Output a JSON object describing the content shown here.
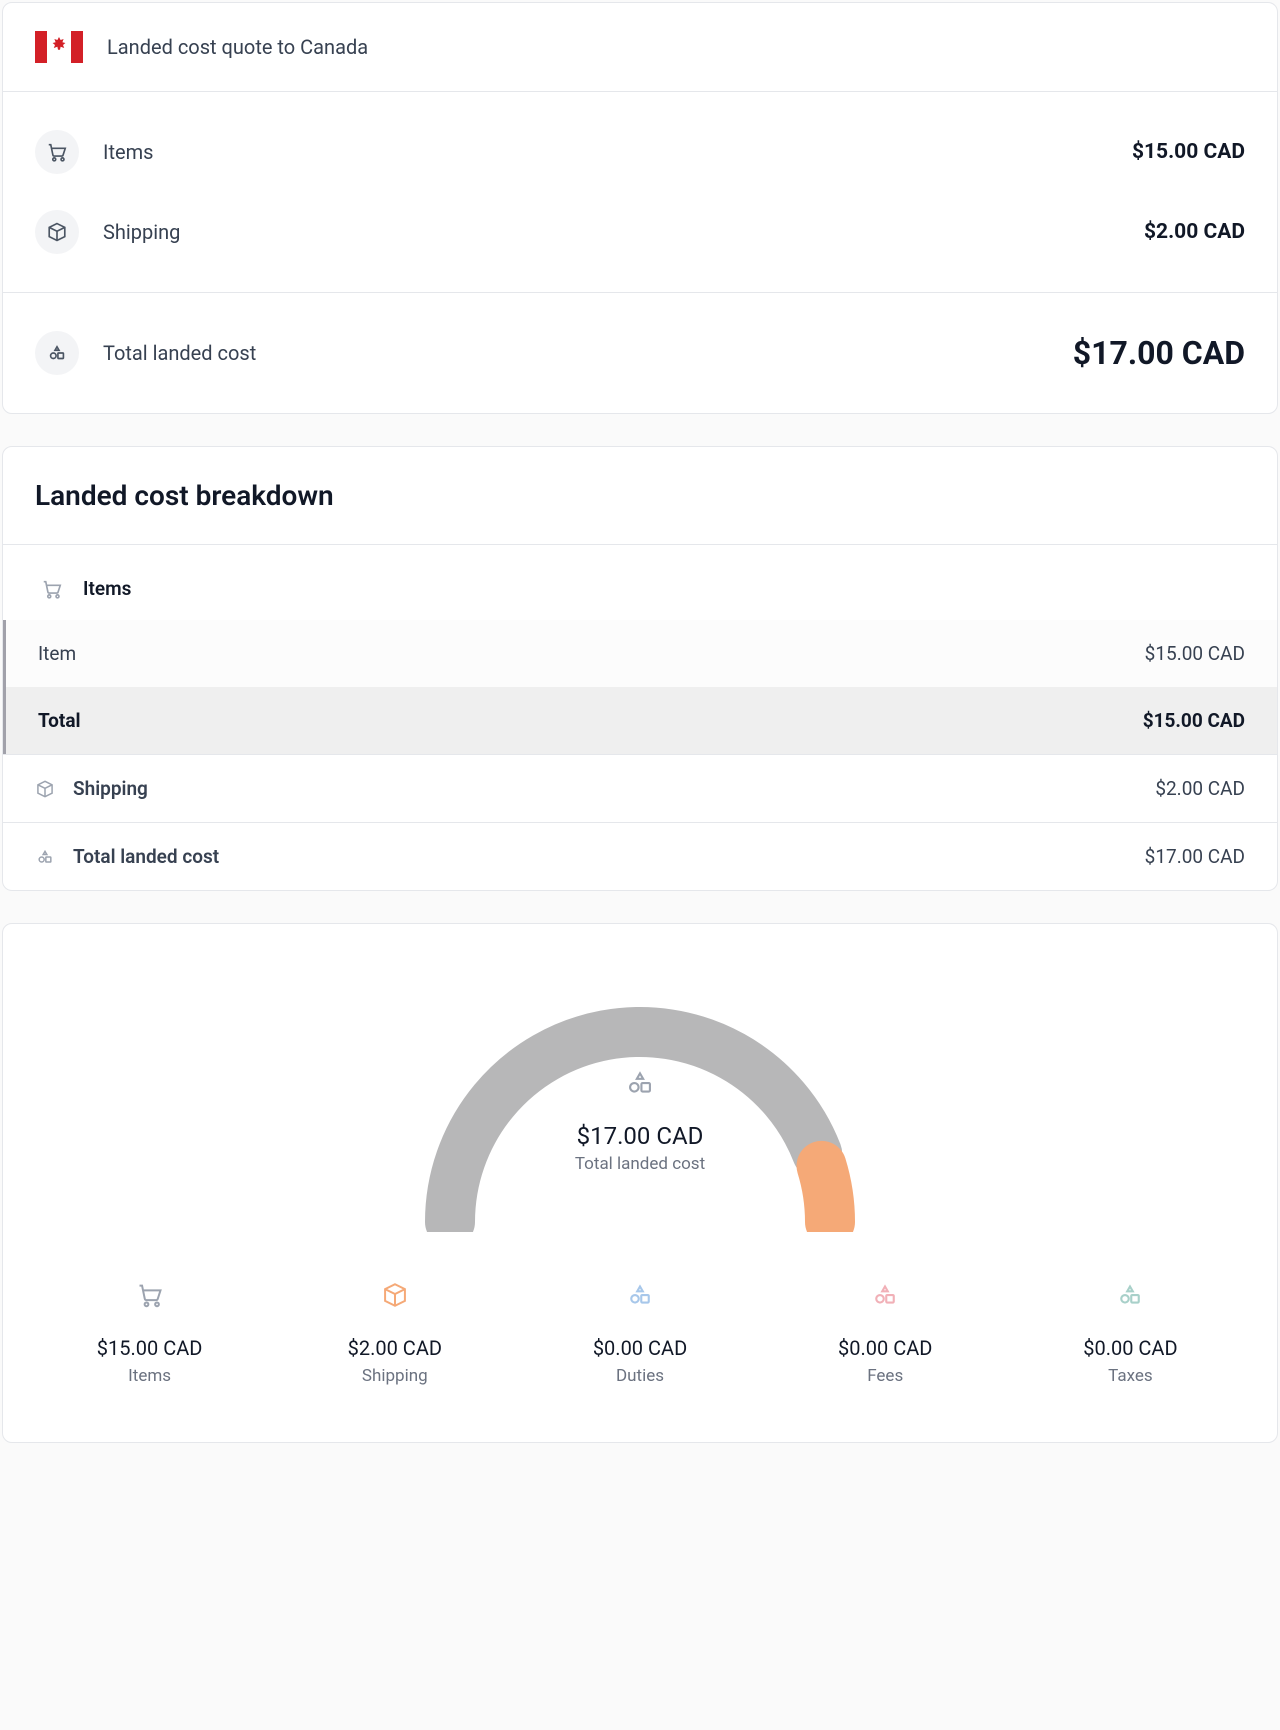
{
  "quote": {
    "title": "Landed cost quote to Canada",
    "lines": [
      {
        "icon": "cart",
        "label": "Items",
        "value": "$15.00 CAD"
      },
      {
        "icon": "box",
        "label": "Shipping",
        "value": "$2.00 CAD"
      }
    ],
    "total": {
      "icon": "shapes",
      "label": "Total landed cost",
      "value": "$17.00 CAD"
    }
  },
  "breakdown": {
    "title": "Landed cost breakdown",
    "items_header": "Items",
    "rows": [
      {
        "label": "Item",
        "value": "$15.00 CAD",
        "total": false
      },
      {
        "label": "Total",
        "value": "$15.00 CAD",
        "total": true
      }
    ],
    "shipping": {
      "icon": "box",
      "label": "Shipping",
      "value": "$2.00 CAD"
    },
    "total": {
      "icon": "shapes",
      "label": "Total landed cost",
      "value": "$17.00 CAD"
    }
  },
  "gauge": {
    "amount": "$17.00 CAD",
    "label": "Total landed cost",
    "legend": [
      {
        "key": "items",
        "icon": "cart",
        "color": "#9ca3af",
        "amount": "$15.00 CAD",
        "label": "Items"
      },
      {
        "key": "shipping",
        "icon": "box",
        "color": "#f5a977",
        "amount": "$2.00 CAD",
        "label": "Shipping"
      },
      {
        "key": "duties",
        "icon": "shapes",
        "color": "#a7c7ea",
        "amount": "$0.00 CAD",
        "label": "Duties"
      },
      {
        "key": "fees",
        "icon": "shapes",
        "color": "#f1b0b7",
        "amount": "$0.00 CAD",
        "label": "Fees"
      },
      {
        "key": "taxes",
        "icon": "shapes",
        "color": "#a8d0c9",
        "amount": "$0.00 CAD",
        "label": "Taxes"
      }
    ]
  },
  "chart_data": {
    "type": "pie",
    "title": "Total landed cost",
    "total": 17.0,
    "currency": "CAD",
    "series": [
      {
        "name": "Items",
        "value": 15.0,
        "color": "#b7b7b8"
      },
      {
        "name": "Shipping",
        "value": 2.0,
        "color": "#f5a977"
      },
      {
        "name": "Duties",
        "value": 0.0,
        "color": "#a7c7ea"
      },
      {
        "name": "Fees",
        "value": 0.0,
        "color": "#f1b0b7"
      },
      {
        "name": "Taxes",
        "value": 0.0,
        "color": "#a8d0c9"
      }
    ]
  }
}
